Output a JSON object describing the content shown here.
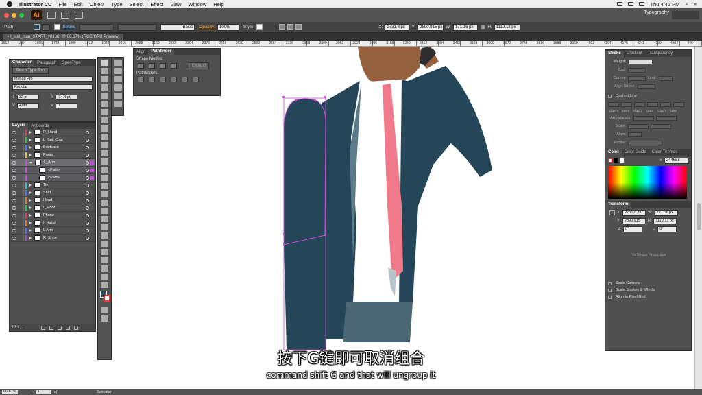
{
  "menubar": {
    "app_name": "Illustrator CC",
    "menus": [
      "File",
      "Edit",
      "Object",
      "Type",
      "Select",
      "Effect",
      "View",
      "Window",
      "Help"
    ],
    "clock": "Thu 4:42 PM"
  },
  "appbar": {
    "logo": "Ai",
    "workspace": "Typography"
  },
  "controlbar": {
    "selection_type": "Path",
    "stroke_label": "Stroke",
    "brush": "Basic",
    "opacity_label": "Opacity:",
    "opacity_value": "100%",
    "style_label": "Style:",
    "x_label": "X:",
    "x_value": "2731.8 px",
    "y_label": "Y:",
    "y_value": "2890.915 px",
    "w_label": "W:",
    "w_value": "171.16 px",
    "h_label": "H:",
    "h_value": "1119.13 px"
  },
  "document": {
    "tab_title": "l_suit_man_START_v01.ai* @ 66.67% (RGB/GPU Preview)"
  },
  "ruler": {
    "ticks": [
      "1512",
      "1584",
      "1656",
      "1728",
      "1800",
      "1872",
      "1944",
      "2016",
      "2088",
      "2160",
      "2232",
      "2304",
      "2376",
      "2448",
      "2520",
      "2592",
      "2664",
      "2736",
      "2808",
      "2880",
      "2952",
      "3024",
      "3096",
      "3168",
      "3240",
      "3312",
      "3384",
      "3456",
      "3528",
      "3600",
      "3672",
      "3744",
      "3816",
      "3888",
      "3960",
      "4032",
      "4104",
      "4176",
      "4248",
      "4320",
      "4392",
      "4464"
    ]
  },
  "character_panel": {
    "tabs": [
      "Character",
      "Paragraph",
      "OpenType"
    ],
    "touch_type_tool": "Touch Type Tool",
    "font_family": "Myriad Pro",
    "font_style": "Regular",
    "font_size": "12 pt",
    "leading": "(14.4 pt)",
    "kerning": "Auto",
    "tracking": "0"
  },
  "layers_panel": {
    "tabs": [
      "Layers",
      "Artboards"
    ],
    "layers": [
      {
        "name": "R_Hand",
        "color": "#e0365a"
      },
      {
        "name": "L_Suit Coat",
        "color": "#31c44c"
      },
      {
        "name": "Briefcase",
        "color": "#4770ff"
      },
      {
        "name": "Pants",
        "color": "#e5c13c"
      },
      {
        "name": "L_Arm",
        "color": "#c64bd6",
        "selected": true
      },
      {
        "name": "<Path>",
        "color": "#c64bd6",
        "sub": true
      },
      {
        "name": "<Path>",
        "color": "#c64bd6",
        "sub": true
      },
      {
        "name": "Tie",
        "color": "#2cc0c7"
      },
      {
        "name": "Shirt",
        "color": "#4770ff"
      },
      {
        "name": "Head",
        "color": "#e27b2a"
      },
      {
        "name": "L_Foot",
        "color": "#31c44c"
      },
      {
        "name": "Phone",
        "color": "#e0365a"
      },
      {
        "name": "I_Hand",
        "color": "#e27b2a"
      },
      {
        "name": "L Arm",
        "color": "#4770ff"
      },
      {
        "name": "R_Shoe",
        "color": "#8e4bd6"
      }
    ],
    "footer_count": "13 L..."
  },
  "pathfinder_panel": {
    "tabs": [
      "Align",
      "Pathfinder"
    ],
    "shape_modes_label": "Shape Modes:",
    "expand_label": "Expand",
    "pathfinders_label": "Pathfinders:"
  },
  "stroke_panel": {
    "tabs": [
      "Stroke",
      "Gradient",
      "Transparency"
    ],
    "weight_label": "Weight:",
    "cap_label": "Cap:",
    "corner_label": "Corner:",
    "limit_label": "Limit:",
    "align_label": "Align Stroke:",
    "dashed_line": "Dashed Line",
    "dash_labels": [
      "dash",
      "gap",
      "dash",
      "gap",
      "dash",
      "gap"
    ],
    "arrowheads_label": "Arrowheads:",
    "scale_label": "Scale:",
    "align2_label": "Align:",
    "profile_label": "Profile:"
  },
  "color_panel": {
    "tabs": [
      "Color",
      "Color Guide",
      "Color Themes"
    ],
    "hex": "244658"
  },
  "transform_panel": {
    "tab": "Transform",
    "x": "2731.8 px",
    "y": "2890.915 px",
    "w": "171.16 px",
    "h": "1119.13 px",
    "angle": "0°",
    "shear": "0°",
    "no_shape": "No Shape Properties",
    "options": [
      "Scale Corners",
      "Scale Strokes & Effects",
      "Align to Pixel Grid"
    ]
  },
  "statusbar": {
    "zoom": "66.67%",
    "artboard": "1",
    "tool": "Selection"
  },
  "subtitles": {
    "chinese": "按下G键即可取消组合",
    "english": "command shift G and that will ungroup it"
  },
  "colors": {
    "suit": "#244658",
    "tie": "#f07a89",
    "skin": "#94603e",
    "pants": "#4a6773",
    "selection": "#c64bd6"
  }
}
